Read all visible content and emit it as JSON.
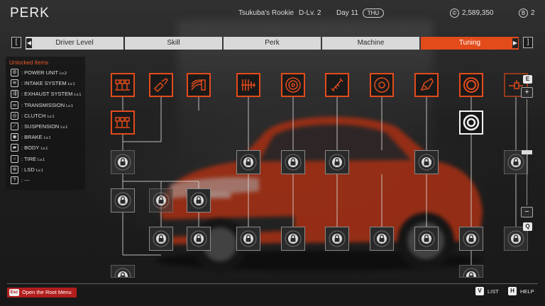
{
  "header": {
    "title": "PERK",
    "profile_name": "Tsukuba's Rookie",
    "driver_level": "D-Lv. 2",
    "day": "Day 11",
    "weekday": "THU",
    "currency_icon": "coin-icon",
    "credits": "2,589,350",
    "b_icon_letter": "B",
    "b_count": "2"
  },
  "tabs": {
    "prev_key": "[",
    "next_key": "]",
    "items": [
      {
        "label": "Driver Level",
        "active": false
      },
      {
        "label": "Skill",
        "active": false
      },
      {
        "label": "Perk",
        "active": false
      },
      {
        "label": "Machine",
        "active": false
      },
      {
        "label": "Tuning",
        "active": true
      }
    ]
  },
  "unlocked": {
    "title": "Unlocked Items",
    "items": [
      {
        "icon": "power-unit-icon",
        "glyph": "⚙",
        "label": "POWER UNIT",
        "level": "Lv.2"
      },
      {
        "icon": "intake-system-icon",
        "glyph": "≋",
        "label": "INTAKE SYSTEM",
        "level": "Lv.1"
      },
      {
        "icon": "exhaust-system-icon",
        "glyph": "⇶",
        "label": "EXHAUST SYSTEM",
        "level": "Lv.1"
      },
      {
        "icon": "transmission-icon",
        "glyph": "⚌",
        "label": "TRANSMISSION",
        "level": "Lv.1"
      },
      {
        "icon": "clutch-icon",
        "glyph": "◎",
        "label": "CLUTCH",
        "level": "Lv.1"
      },
      {
        "icon": "suspension-icon",
        "glyph": "⟋",
        "label": "SUSPENSION",
        "level": "Lv.1"
      },
      {
        "icon": "brake-icon",
        "glyph": "◉",
        "label": "BRAKE",
        "level": "Lv.1"
      },
      {
        "icon": "body-icon",
        "glyph": "▰",
        "label": "BODY",
        "level": "Lv.1"
      },
      {
        "icon": "tire-icon",
        "glyph": "○",
        "label": "TIRE",
        "level": "Lv.1"
      },
      {
        "icon": "lsd-icon",
        "glyph": "⊛",
        "label": "LSD",
        "level": "Lv.1"
      },
      {
        "icon": "unknown-icon",
        "glyph": "?",
        "label": "---",
        "level": ""
      }
    ]
  },
  "scroll": {
    "up_key": "E",
    "down_key": "Q",
    "zoom_in": "+",
    "zoom_out": "−"
  },
  "footer": {
    "esc_key": "Esc",
    "esc_label": "Open the Root Menu",
    "list_key": "V",
    "list_label": "LIST",
    "help_key": "H",
    "help_label": "HELP"
  },
  "colors": {
    "accent": "#e34b1b",
    "locked_border": "#8a8a8a",
    "selected_border": "#f2f2f2",
    "esc_bg": "#b21e1e"
  }
}
